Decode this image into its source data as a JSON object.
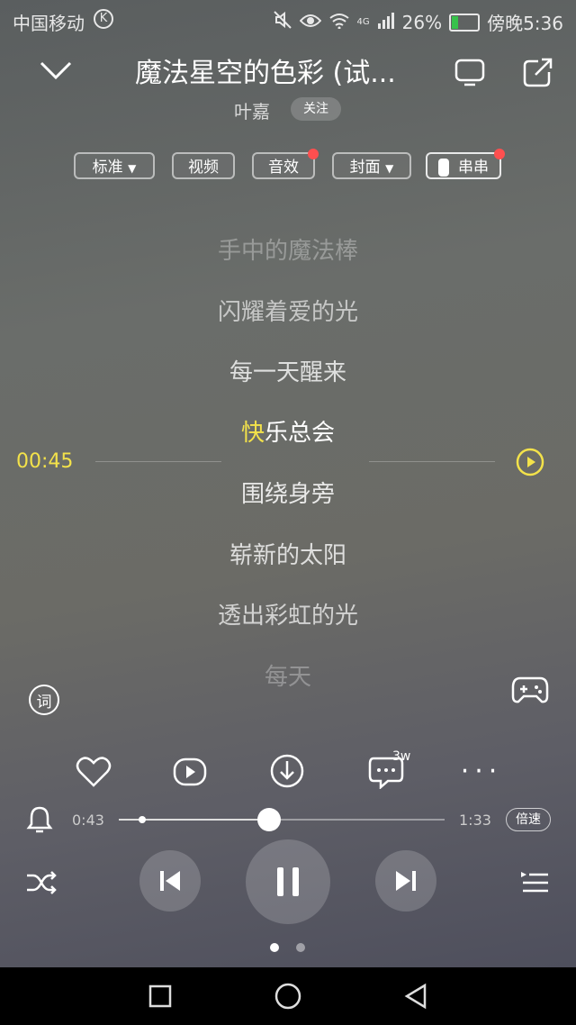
{
  "status_bar": {
    "carrier": "中国移动",
    "carrier_badge": "K",
    "network": "4G",
    "battery_percent": "26%",
    "battery_level": 0.26,
    "time": "傍晚5:36"
  },
  "header": {
    "title": "魔法星空的色彩 (试...",
    "artist": "叶嘉",
    "follow_label": "关注"
  },
  "toolbar": {
    "standard": "标准",
    "video": "视频",
    "sound_effect": "音效",
    "cover": "封面",
    "chuanchuan": "串串"
  },
  "lyrics": [
    {
      "text": "手中的魔法棒",
      "state": "past"
    },
    {
      "text": "闪耀着爱的光",
      "state": "past"
    },
    {
      "text": "每一天醒来",
      "state": "past"
    },
    {
      "text": "快乐总会",
      "state": "current"
    },
    {
      "text": "围绕身旁",
      "state": "next"
    },
    {
      "text": "崭新的太阳",
      "state": "next"
    },
    {
      "text": "透出彩虹的光",
      "state": "next"
    },
    {
      "text": "每天",
      "state": "fading"
    }
  ],
  "lyric_time": "00:45",
  "lyric_button_label": "词",
  "actions": {
    "comment_count": "3w"
  },
  "player": {
    "position": "0:43",
    "duration": "1:33",
    "progress": 0.46,
    "speed_label": "倍速"
  },
  "page_indicator": {
    "count": 2,
    "active": 0
  },
  "colors": {
    "accent_yellow": "#f3e24a",
    "red_dot": "#ff4f4f",
    "battery_green": "#37c24b"
  }
}
